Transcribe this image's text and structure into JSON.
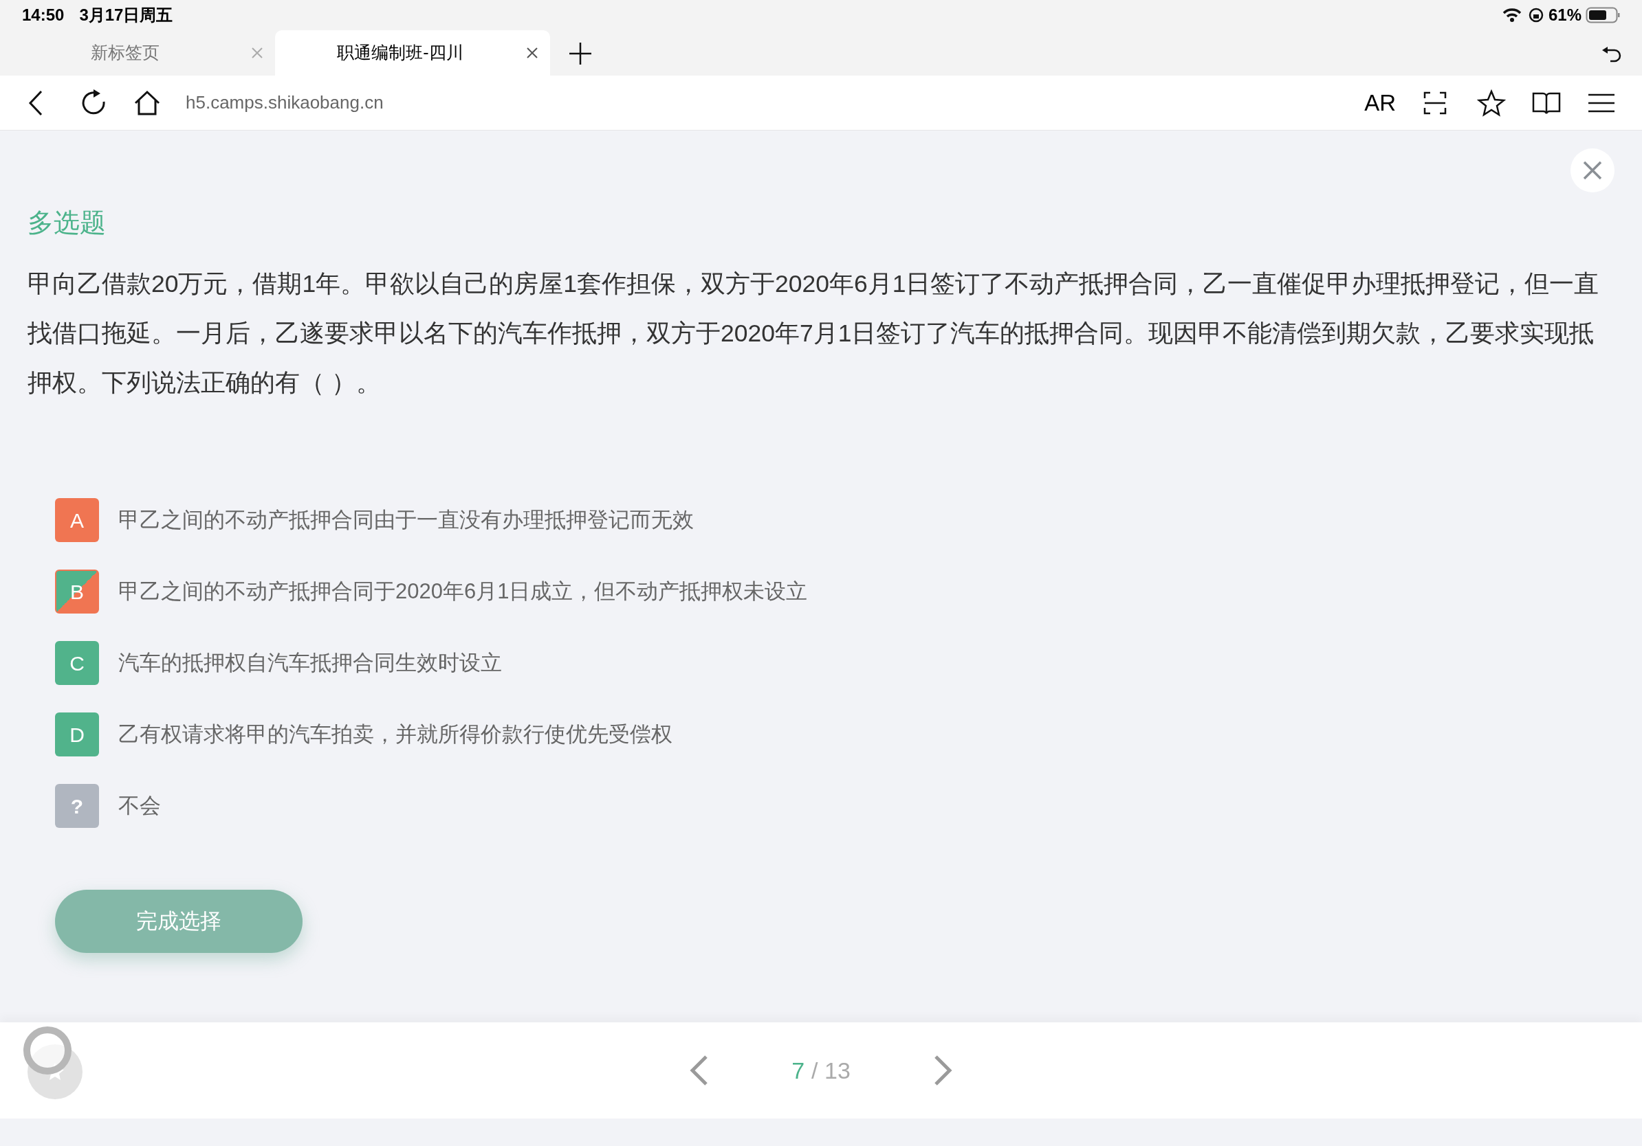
{
  "status_bar": {
    "time": "14:50",
    "date": "3月17日周五",
    "battery": "61%"
  },
  "tabs": [
    {
      "label": "新标签页",
      "selected": false
    },
    {
      "label": "职通编制班-四川",
      "selected": true
    }
  ],
  "address_bar": {
    "url": "h5.camps.shikaobang.cn",
    "ar": "AR"
  },
  "question": {
    "type_label": "多选题",
    "text": "甲向乙借款20万元，借期1年。甲欲以自己的房屋1套作担保，双方于2020年6月1日签订了不动产抵押合同，乙一直催促甲办理抵押登记，但一直找借口拖延。一月后，乙遂要求甲以名下的汽车作抵押，双方于2020年7月1日签订了汽车的抵押合同。现因甲不能清偿到期欠款，乙要求实现抵押权。下列说法正确的有（ ）。"
  },
  "options": [
    {
      "letter": "A",
      "text": "甲乙之间的不动产抵押合同由于一直没有办理抵押登记而无效",
      "kind": "wrong"
    },
    {
      "letter": "B",
      "text": "甲乙之间的不动产抵押合同于2020年6月1日成立，但不动产抵押权未设立",
      "kind": "mixed"
    },
    {
      "letter": "C",
      "text": "汽车的抵押权自汽车抵押合同生效时设立",
      "kind": "correct"
    },
    {
      "letter": "D",
      "text": "乙有权请求将甲的汽车拍卖，并就所得价款行使优先受偿权",
      "kind": "correct"
    },
    {
      "letter": "?",
      "text": "不会",
      "kind": "unknown"
    }
  ],
  "submit_button": "完成选择",
  "pager": {
    "current": "7",
    "total": "/ 13"
  }
}
